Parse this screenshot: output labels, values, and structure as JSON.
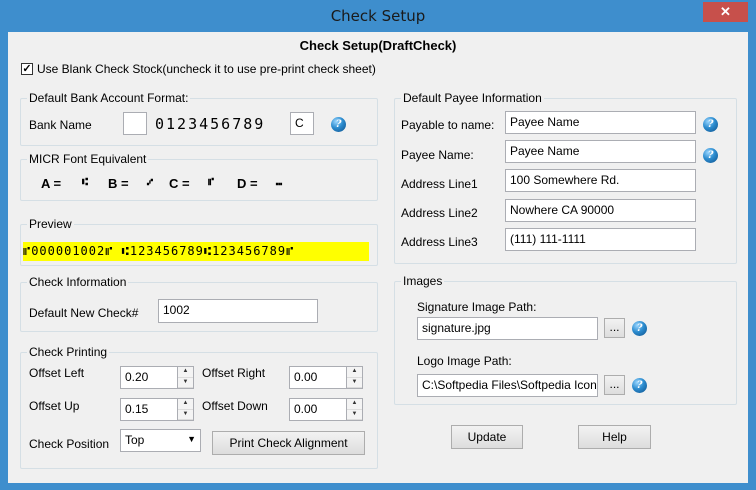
{
  "window": {
    "title": "Check Setup",
    "close_label": "✕"
  },
  "heading": "Check Setup(DraftCheck)",
  "blank_stock": {
    "label": "Use Blank Check Stock(uncheck it to use pre-print check sheet)",
    "checked": true
  },
  "bank_format": {
    "group_label": "Default Bank Account Format:",
    "bank_name_label": "Bank Name",
    "bank_name_value": "",
    "micr_digits": "0123456789",
    "code_value": "C"
  },
  "micr_font": {
    "group_label": "MICR Font Equivalent",
    "items": [
      {
        "letter": "A =",
        "symbol": "⑆"
      },
      {
        "letter": "B =",
        "symbol": "⑇"
      },
      {
        "letter": "C =",
        "symbol": "⑈"
      },
      {
        "letter": "D =",
        "symbol": "⑉"
      }
    ]
  },
  "preview": {
    "group_label": "Preview",
    "text": "⑈000001002⑈ ⑆123456789⑆123456789⑈",
    "highlight": "#ffff00"
  },
  "check_info": {
    "group_label": "Check Information",
    "new_check_label": "Default New Check#",
    "new_check_value": "1002"
  },
  "check_printing": {
    "group_label": "Check Printing",
    "offset_left_label": "Offset Left",
    "offset_left_value": "0.20",
    "offset_right_label": "Offset Right",
    "offset_right_value": "0.00",
    "offset_up_label": "Offset Up",
    "offset_up_value": "0.15",
    "offset_down_label": "Offset Down",
    "offset_down_value": "0.00",
    "position_label": "Check Position",
    "position_value": "Top",
    "print_alignment_label": "Print Check Alignment"
  },
  "payee": {
    "group_label": "Default Payee Information",
    "payable_label": "Payable to name:",
    "payable_value": "Payee Name",
    "payee_name_label": "Payee Name:",
    "payee_name_value": "Payee Name",
    "addr1_label": "Address Line1",
    "addr1_value": "100 Somewhere Rd.",
    "addr2_label": "Address Line2",
    "addr2_value": "Nowhere CA 90000",
    "addr3_label": "Address Line3",
    "addr3_value": "(111) 111-1111"
  },
  "images": {
    "group_label": "Images",
    "signature_label": "Signature Image Path:",
    "signature_value": "signature.jpg",
    "logo_label": "Logo Image Path:",
    "logo_value": "C:\\Softpedia Files\\Softpedia Icon",
    "browse_label": "..."
  },
  "buttons": {
    "update": "Update",
    "help": "Help"
  },
  "help_icon_glyph": "?"
}
